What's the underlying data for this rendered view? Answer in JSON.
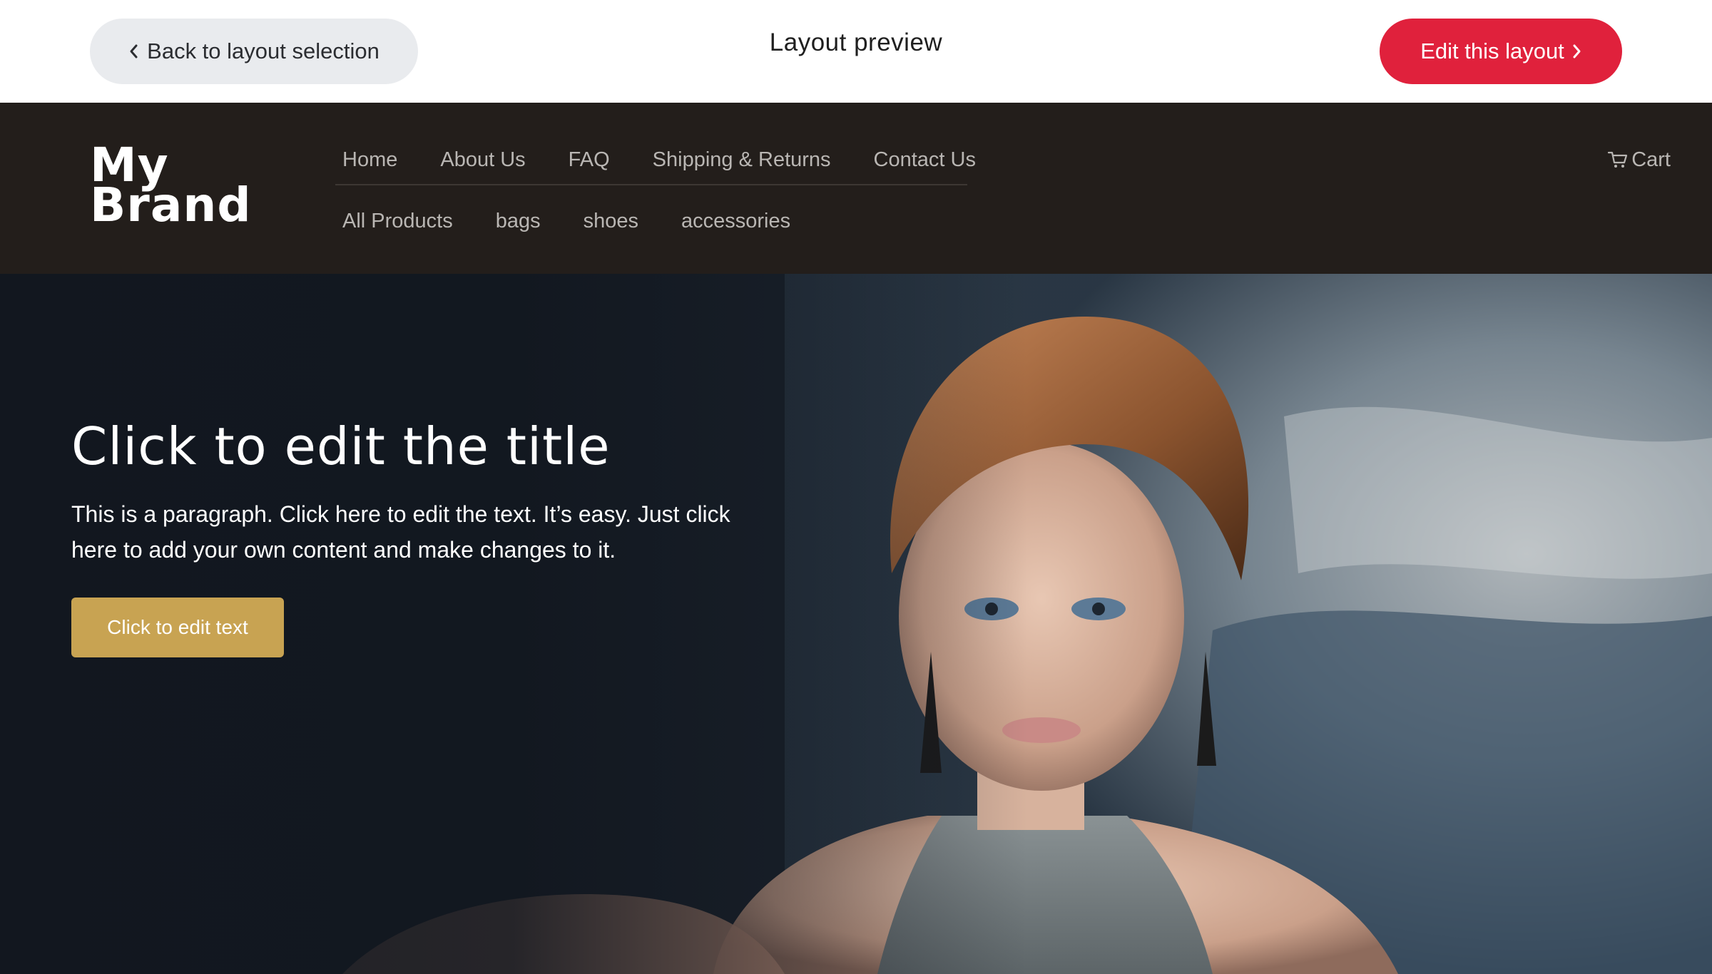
{
  "toolbar": {
    "back_label": "Back to layout selection",
    "title": "Layout preview",
    "edit_label": "Edit this layout"
  },
  "header": {
    "logo_line1": "My",
    "logo_line2": "Brand",
    "nav_primary": [
      "Home",
      "About Us",
      "FAQ",
      "Shipping & Returns",
      "Contact Us"
    ],
    "nav_secondary": [
      "All Products",
      "bags",
      "shoes",
      "accessories"
    ],
    "cart_label": "Cart"
  },
  "hero": {
    "title": "Click to edit the title",
    "paragraph": "This is a paragraph. Click here to edit the text. It’s easy. Just click here to add your own content and make changes to it.",
    "button_label": "Click to edit text"
  },
  "colors": {
    "accent_red": "#e0213c",
    "back_button_bg": "#e9ebee",
    "header_bg": "#231e1b",
    "hero_button_gold": "#c8a352",
    "nav_text": "#b9b6b3"
  },
  "icons": {
    "back": "chevron-left-icon",
    "edit": "chevron-right-icon",
    "cart": "cart-icon"
  }
}
